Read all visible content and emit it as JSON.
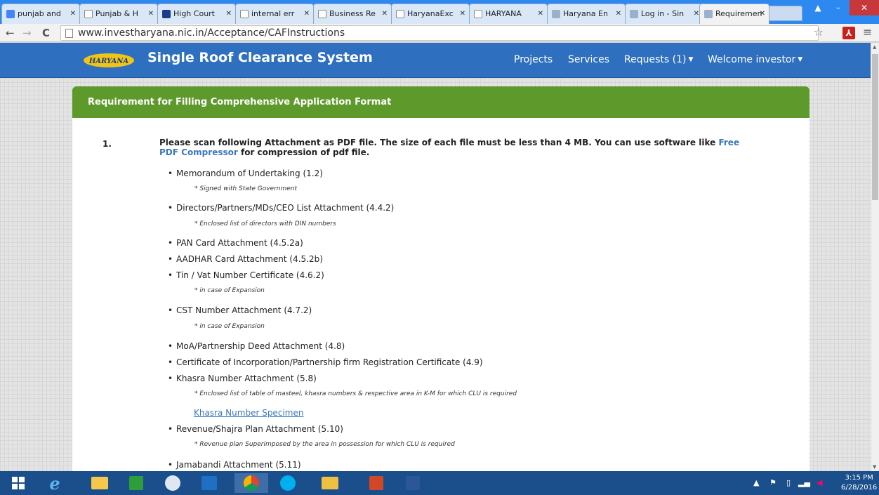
{
  "browser": {
    "tabs": [
      {
        "label": "punjab and",
        "color": "#4285f4"
      },
      {
        "label": "Punjab & H",
        "color": "#888888"
      },
      {
        "label": "High Court",
        "color": "#1a3c8a"
      },
      {
        "label": "internal err",
        "color": "#888888"
      },
      {
        "label": "Business Re",
        "color": "#888888"
      },
      {
        "label": "HaryanaExc",
        "color": "#888888"
      },
      {
        "label": "HARYANA",
        "color": "#888888"
      },
      {
        "label": "Haryana En",
        "color": "#9ab0cc"
      },
      {
        "label": "Log in - Sin",
        "color": "#9ab0cc"
      },
      {
        "label": "Requiremen",
        "color": "#9ab0cc"
      }
    ],
    "url": "www.investharyana.nic.in/Acceptance/CAFInstructions"
  },
  "site": {
    "logo_text": "HARYANA",
    "title": "Single Roof Clearance System",
    "nav": {
      "projects": "Projects",
      "services": "Services",
      "requests": "Requests (1)",
      "welcome": "Welcome investor"
    }
  },
  "panel": {
    "heading": "Requirement for Filling Comprehensive Application Format",
    "number": "1.",
    "intro_before": "Please scan following Attachment as PDF file. The size of each file must be less than 4 MB. You can use software like",
    "intro_link": "Free PDF Compressor",
    "intro_after": "for compression of pdf file.",
    "items": [
      {
        "label": "Memorandum of Undertaking (1.2)",
        "note": "* Signed with State Government"
      },
      {
        "label": "Directors/Partners/MDs/CEO List Attachment (4.4.2)",
        "note": "* Enclosed list of directors with DIN numbers"
      },
      {
        "label": "PAN Card Attachment (4.5.2a)"
      },
      {
        "label": "AADHAR Card Attachment (4.5.2b)"
      },
      {
        "label": "Tin / Vat Number Certificate (4.6.2)",
        "note": "* in case of Expansion"
      },
      {
        "label": "CST Number Attachment (4.7.2)",
        "note": "* in case of Expansion"
      },
      {
        "label": "MoA/Partnership Deed Attachment (4.8)"
      },
      {
        "label": "Certificate of Incorporation/Partnership firm Registration Certificate (4.9)"
      },
      {
        "label": "Khasra Number Attachment (5.8)",
        "note": "* Enclosed list of table of masteel, khasra numbers & respective area in K-M for which CLU is required"
      },
      {
        "label": "Revenue/Shajra Plan Attachment (5.10)",
        "note": "* Revenue plan Superimposed by the area in possession for which CLU is required"
      },
      {
        "label": "Jamabandi Attachment (5.11)"
      }
    ],
    "specimen_link": "Khasra Number Specimen"
  },
  "taskbar": {
    "time": "3:15 PM",
    "date": "6/28/2016"
  },
  "colors": {
    "nav_bg": "#2e70bf",
    "panel_header": "#5e9a2b",
    "link": "#3a78b8",
    "taskbar": "#1b4f8c"
  }
}
